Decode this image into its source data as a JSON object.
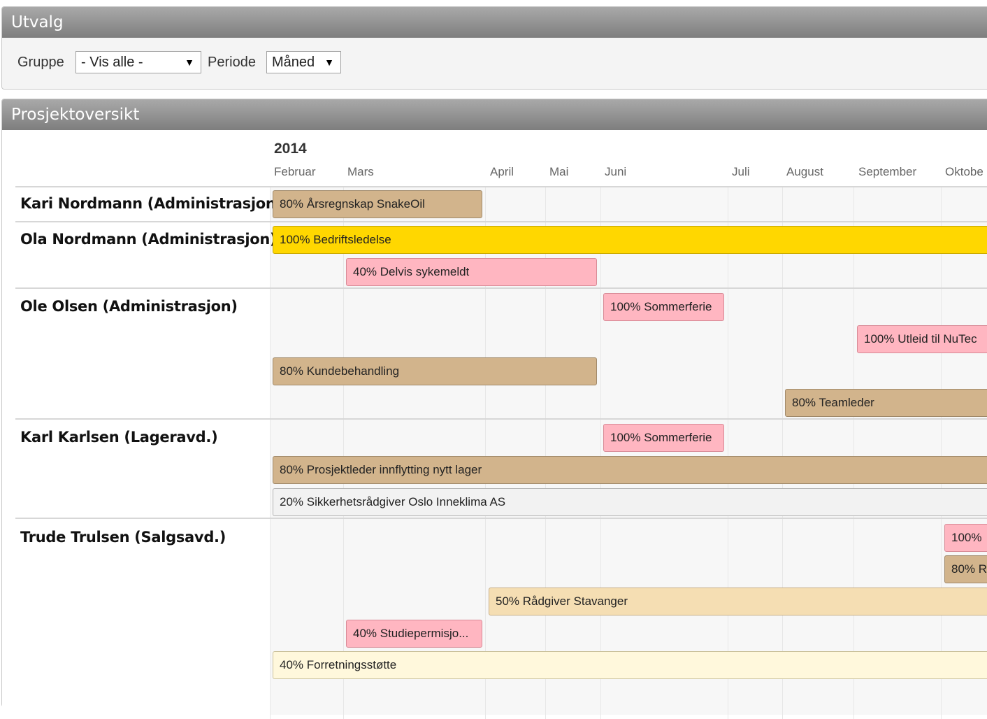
{
  "utvalg": {
    "title": "Utvalg",
    "gruppe_label": "Gruppe",
    "gruppe_value": "- Vis alle -",
    "periode_label": "Periode",
    "periode_value": "Måned"
  },
  "prosjekt": {
    "title": "Prosjektoversikt",
    "year": "2014",
    "months": [
      "Februar",
      "Mars",
      "April",
      "Mai",
      "Juni",
      "Juli",
      "August",
      "September",
      "Oktobe"
    ],
    "people": [
      {
        "name": "Kari Nordmann (Administrasjon)",
        "bars": [
          {
            "label": "80% Årsregnskap SnakeOil",
            "color": "#d2b48c"
          }
        ]
      },
      {
        "name": "Ola Nordmann (Administrasjon)",
        "bars": [
          {
            "label": "100% Bedriftsledelse",
            "color": "#ffd700"
          },
          {
            "label": "40% Delvis sykemeldt",
            "color": "#ffb6c1"
          }
        ]
      },
      {
        "name": "Ole Olsen (Administrasjon)",
        "bars": [
          {
            "label": "100% Sommerferie",
            "color": "#ffb6c1"
          },
          {
            "label": "100% Utleid til NuTec",
            "color": "#ffb6c1"
          },
          {
            "label": "80% Kundebehandling",
            "color": "#d2b48c"
          },
          {
            "label": "80% Teamleder",
            "color": "#d2b48c"
          }
        ]
      },
      {
        "name": "Karl Karlsen (Lageravd.)",
        "bars": [
          {
            "label": "100% Sommerferie",
            "color": "#ffb6c1"
          },
          {
            "label": "80% Prosjektleder innflytting nytt lager",
            "color": "#d2b48c"
          },
          {
            "label": "20% Sikkerhetsrådgiver Oslo Inneklima AS",
            "color": "#f2f2f2"
          }
        ]
      },
      {
        "name": "Trude Trulsen (Salgsavd.)",
        "bars": [
          {
            "label": "100%",
            "color": "#ffb6c1"
          },
          {
            "label": "80% R",
            "color": "#d2b48c"
          },
          {
            "label": "50% Rådgiver Stavanger",
            "color": "#f5deb3"
          },
          {
            "label": "40% Studiepermisjo...",
            "color": "#ffb6c1"
          },
          {
            "label": "40% Forretningsstøtte",
            "color": "#fff8dc"
          }
        ]
      }
    ]
  }
}
